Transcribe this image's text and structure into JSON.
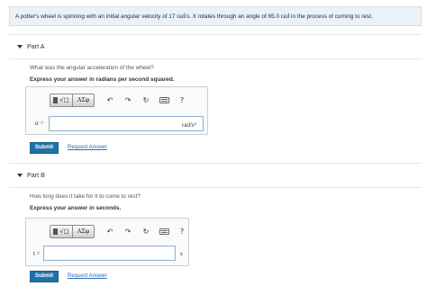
{
  "problem": {
    "text_before": "A potter's wheel is spinning with an initial angular velocity of 17 ",
    "velocity_unit": "rad/s",
    "text_middle": ". It rotates through an angle of 65.0 ",
    "angle_unit": "rad",
    "text_after": " in the process of coming to rest."
  },
  "parts": [
    {
      "title": "Part A",
      "question": "What was the angular acceleration of the wheel?",
      "instruction": "Express your answer in radians per second squared.",
      "variable": "α =",
      "answer_value": "",
      "unit": "rad/s²",
      "submit_label": "Submit",
      "request_label": "Request Answer"
    },
    {
      "title": "Part B",
      "question": "How long does it take for it to come to rest?",
      "instruction": "Express your answer in seconds.",
      "variable": "t =",
      "answer_value": "",
      "unit": "s",
      "submit_label": "Submit",
      "request_label": "Request Answer"
    }
  ],
  "toolbar": {
    "templates_label": "√□",
    "greek_label": "ΑΣφ",
    "undo_icon": "↶",
    "redo_icon": "↷",
    "reset_icon": "↻",
    "keyboard_icon": "keyboard-icon",
    "help_label": "?"
  },
  "colors": {
    "problem_bg": "#eaf1f8",
    "submit_bg": "#1f72a7",
    "link": "#2a6ebb",
    "answer_border": "#8fb5d9"
  }
}
